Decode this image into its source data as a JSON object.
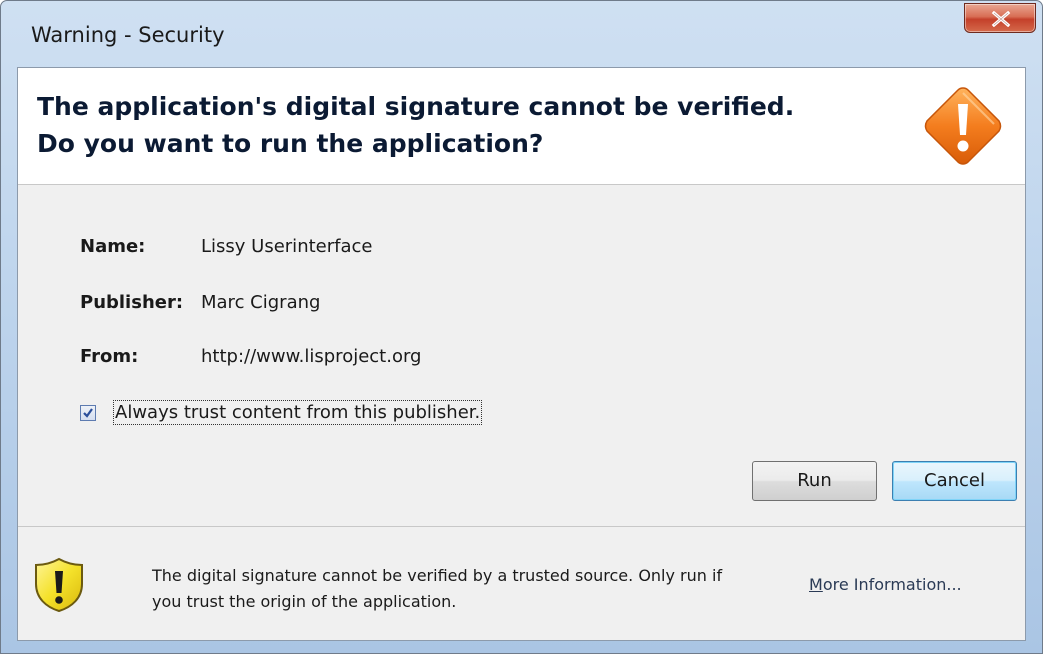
{
  "window": {
    "title": "Warning - Security",
    "close_symbol": "X"
  },
  "header": {
    "headline_line1": "The application's digital signature cannot be verified.",
    "headline_line2": "Do you want to run the application?",
    "icon": "warning-diamond-icon"
  },
  "details": [
    {
      "label": "Name:",
      "value": "Lissy Userinterface"
    },
    {
      "label": "Publisher:",
      "value": "Marc Cigrang"
    },
    {
      "label": "From:",
      "value": "http://www.lisproject.org"
    }
  ],
  "trust": {
    "checked": true,
    "label": "Always trust content from this publisher."
  },
  "buttons": {
    "run": "Run",
    "cancel": "Cancel"
  },
  "footer": {
    "icon": "shield-warning-icon",
    "message": "The digital signature cannot be verified by a trusted source.  Only run if you trust the origin of the application.",
    "link_first_letter": "M",
    "link_rest": "ore Information..."
  },
  "colors": {
    "warning_orange": "#f07c1c",
    "shield_yellow": "#f4e12a",
    "close_red": "#c4402a",
    "default_button_blue": "#3c7fb1"
  }
}
